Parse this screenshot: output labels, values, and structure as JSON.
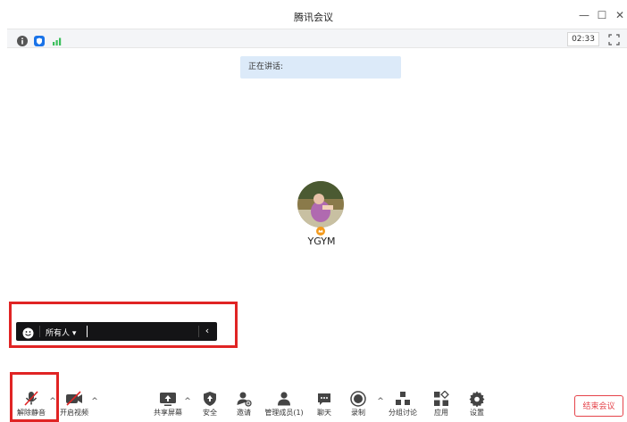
{
  "window": {
    "title": "腾讯会议"
  },
  "status": {
    "timer": "02:33"
  },
  "banner": {
    "speaking_label": "正在讲话:"
  },
  "participant": {
    "name": "YGYM"
  },
  "chat": {
    "recipient": "所有人",
    "recipient_caret": "▾",
    "collapse": "‹"
  },
  "toolbar": {
    "unmute": "解除静音",
    "start_video": "开启视频",
    "share_screen": "共享屏幕",
    "security": "安全",
    "invite": "邀请",
    "manage_members": "管理成员(1)",
    "chat": "聊天",
    "record": "录制",
    "breakout": "分组讨论",
    "apps": "应用",
    "settings": "设置",
    "end_meeting": "结束会议",
    "caret": "^"
  },
  "colors": {
    "accent_red": "#e02424",
    "end_red": "#e5434a",
    "banner_bg": "#dceaf9",
    "icon_blue": "#1a73e8",
    "signal_green": "#3bbf5b"
  }
}
